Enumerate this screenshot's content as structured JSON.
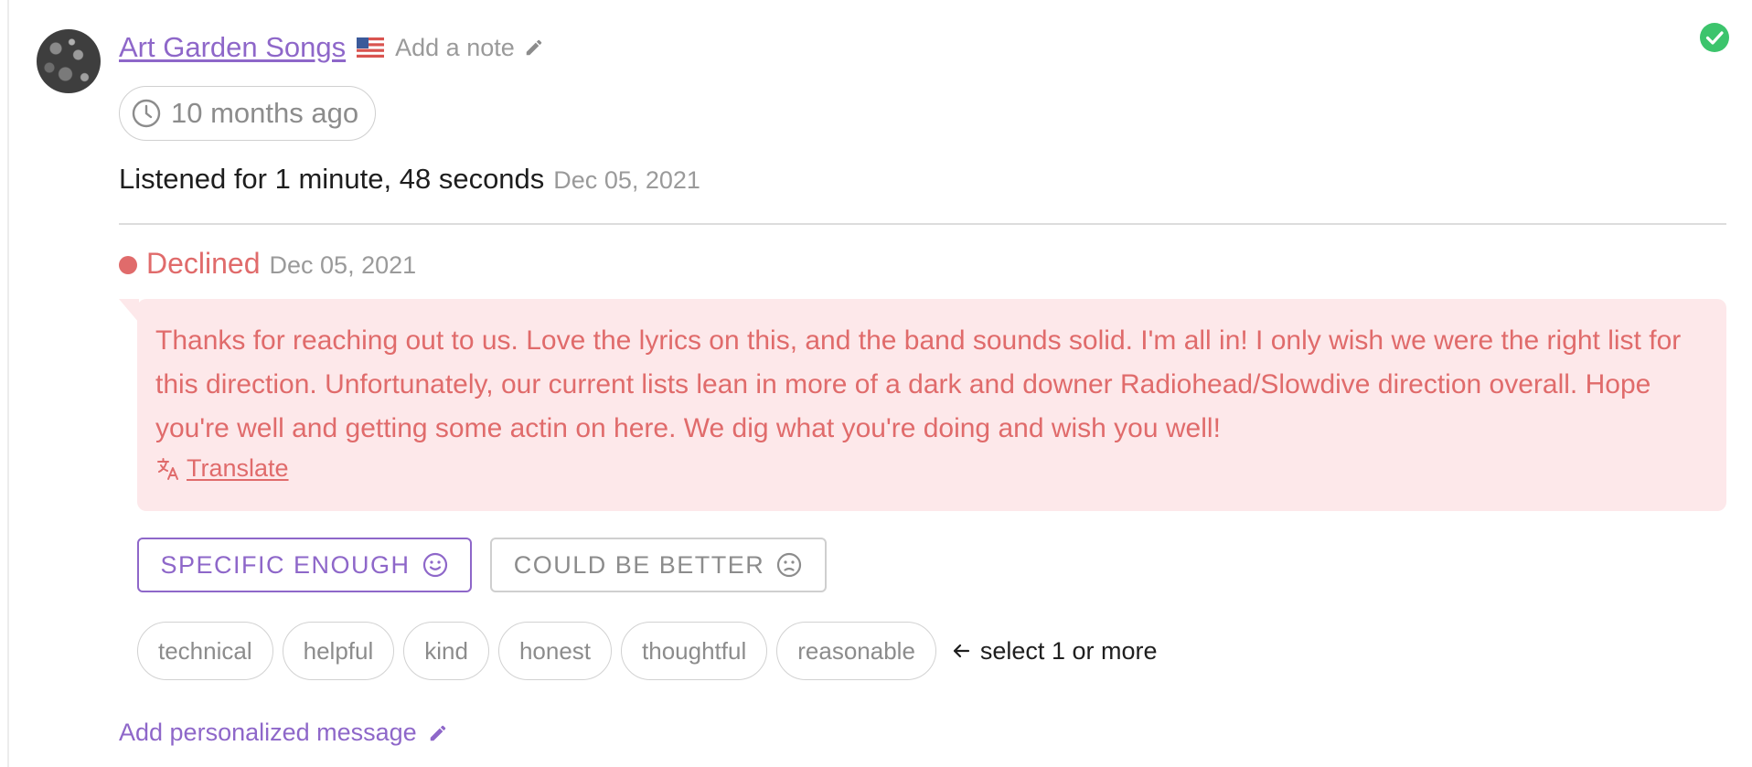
{
  "colors": {
    "accent": "#8e67c9",
    "declined": "#e06b6b",
    "declined_bg": "#fde8ea",
    "success": "#3cc46c",
    "muted": "#9a9a9a"
  },
  "header": {
    "artist_name": "Art Garden Songs",
    "flag_icon": "us-flag-icon",
    "add_note_label": "Add a note"
  },
  "time_pill": {
    "label": "10 months ago"
  },
  "listen": {
    "text": "Listened for 1 minute, 48 seconds",
    "date": "Dec 05, 2021"
  },
  "status": {
    "label": "Declined",
    "date": "Dec 05, 2021"
  },
  "message": {
    "text": "Thanks for reaching out to us. Love the lyrics on this, and the band sounds solid. I'm all in! I only wish we were the right list for this direction. Unfortunately, our current lists lean in more of a dark and downer Radiohead/Slowdive direction overall. Hope you're well and getting some actin on here. We dig what you're doing and wish you well!",
    "translate_label": "Translate"
  },
  "rating": {
    "specific_label": "SPECIFIC ENOUGH",
    "better_label": "COULD BE BETTER"
  },
  "tags": [
    "technical",
    "helpful",
    "kind",
    "honest",
    "thoughtful",
    "reasonable"
  ],
  "tags_hint": "select 1 or more",
  "add_message_label": "Add personalized message"
}
